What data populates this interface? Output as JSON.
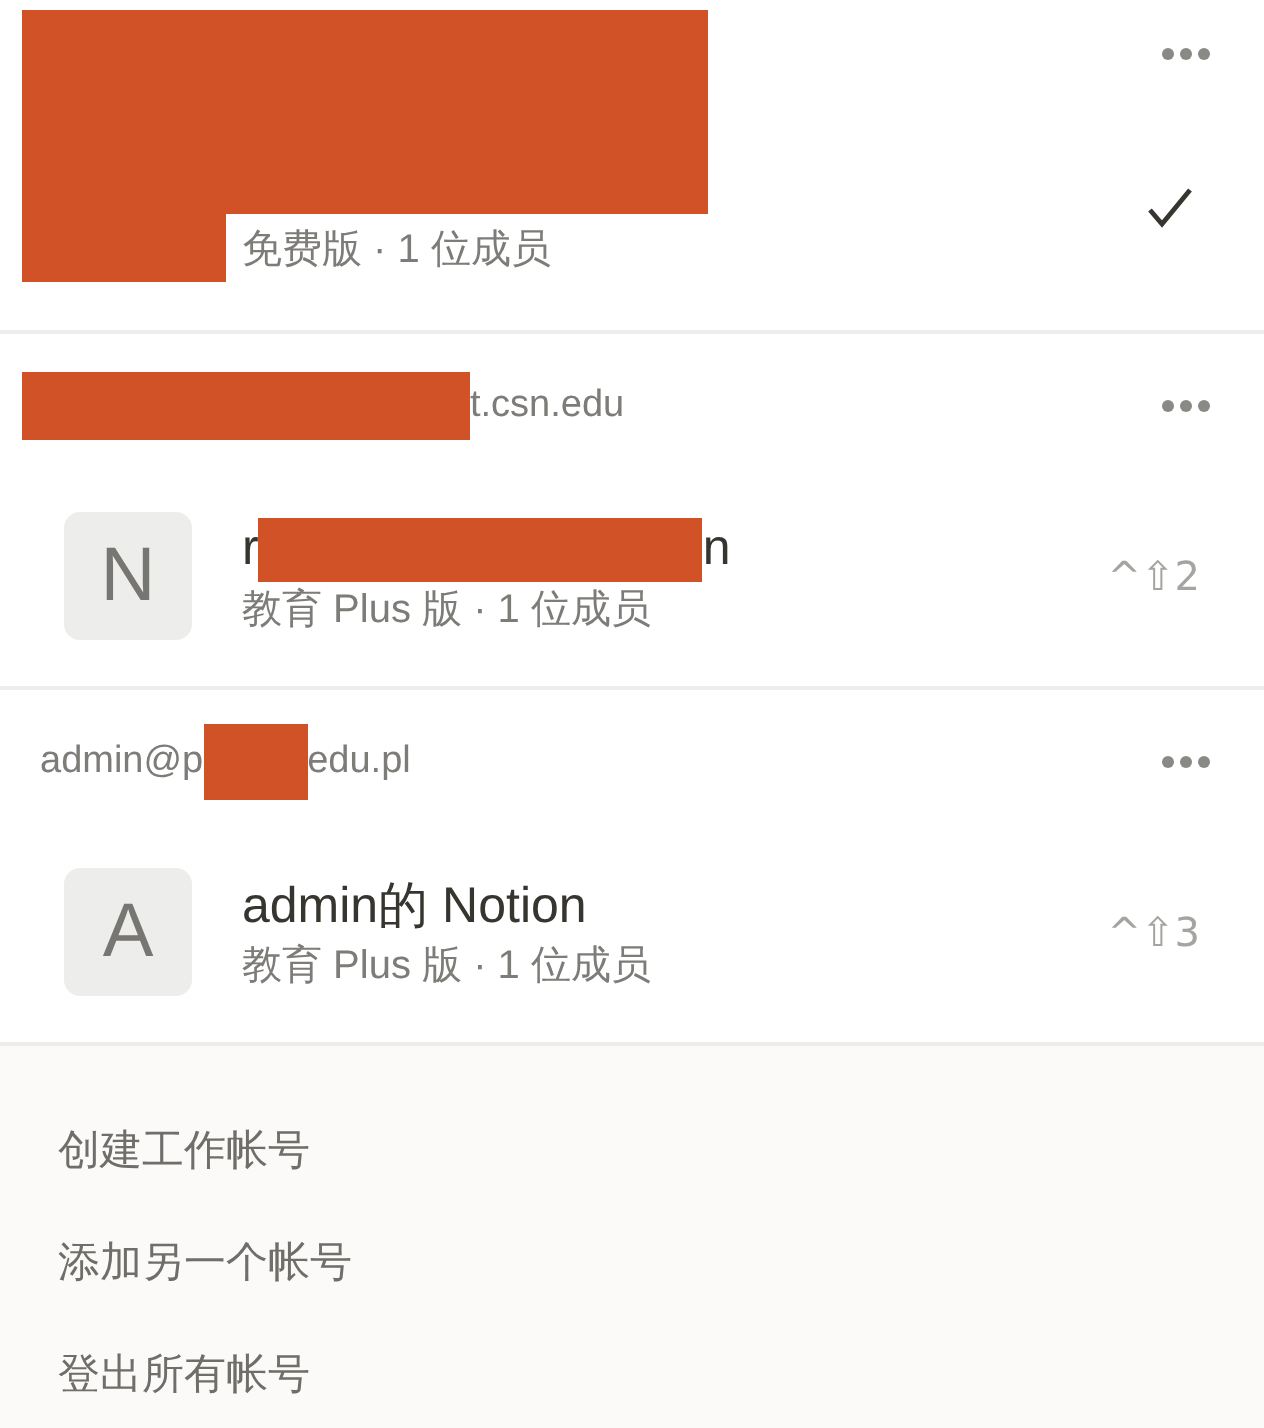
{
  "accounts": [
    {
      "kind": "redacted",
      "plan": "免费版 · 1 位成员",
      "selected": true
    },
    {
      "kind": "account",
      "email": [
        {
          "kind": "redacted"
        },
        {
          "kind": "text",
          "text": "t.csn.edu"
        }
      ],
      "workspace": {
        "initial": "N",
        "name": [
          {
            "kind": "text",
            "text": "r"
          },
          {
            "kind": "redacted"
          },
          {
            "kind": "text",
            "text": "n"
          }
        ],
        "plan": "教育 Plus 版 · 1 位成员",
        "shortcut": "^⇧2",
        "selected": false
      }
    },
    {
      "kind": "account",
      "email": [
        {
          "kind": "text",
          "text": "admin@p"
        },
        {
          "kind": "redacted"
        },
        {
          "kind": "text",
          "text": "edu.pl"
        }
      ],
      "workspace": {
        "initial": "A",
        "name": [
          {
            "kind": "text",
            "text": "admin的 Notion"
          }
        ],
        "plan": "教育 Plus 版 · 1 位成员",
        "shortcut": "^⇧3",
        "selected": false
      }
    }
  ],
  "actions": [
    "创建工作帐号",
    "添加另一个帐号",
    "登出所有帐号"
  ]
}
